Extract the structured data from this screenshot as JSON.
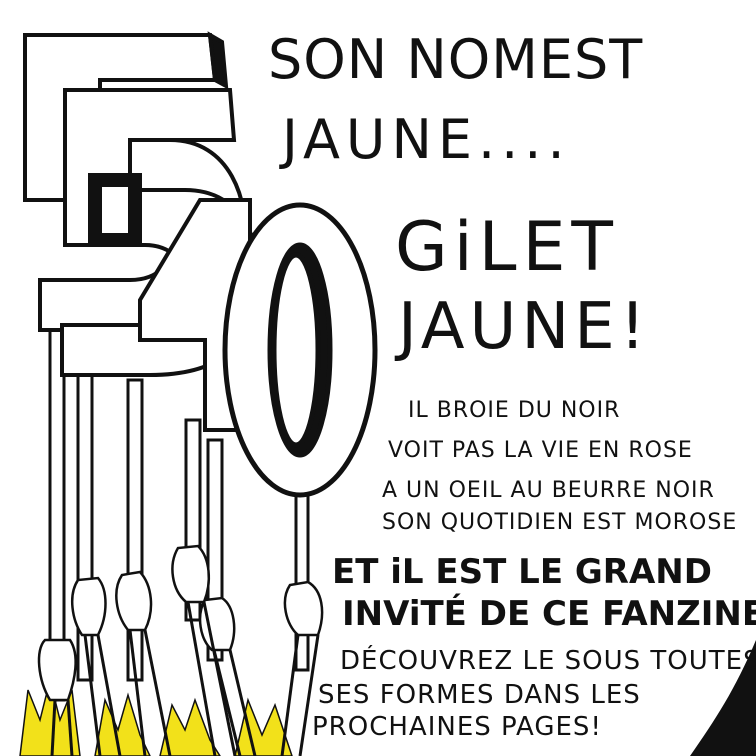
{
  "headline": {
    "line1": "SON NOMEST",
    "line2": "JAUNE....",
    "line3": "GiLET",
    "line4": "JAUNE!"
  },
  "verse": [
    "IL BROIE DU NOIR",
    "VOIT PAS LA VIE EN ROSE",
    "A UN OEIL AU BEURRE NOIR",
    "SON QUOTIDIEN EST MOROSE"
  ],
  "announcement": {
    "line1": "ET iL EST LE GRAND",
    "line2": "INViTÉ DE CE FANZINE!"
  },
  "closing": [
    "DÉCOUVREZ LE SOUS TOUTES",
    "SES FORMES DANS LES",
    "PROCHAINES PAGES!"
  ],
  "signs": [
    "5",
    "5",
    "4",
    "0"
  ],
  "colors": {
    "ink": "#111111",
    "paper": "#ffffff",
    "flame": "#f2e11a"
  }
}
